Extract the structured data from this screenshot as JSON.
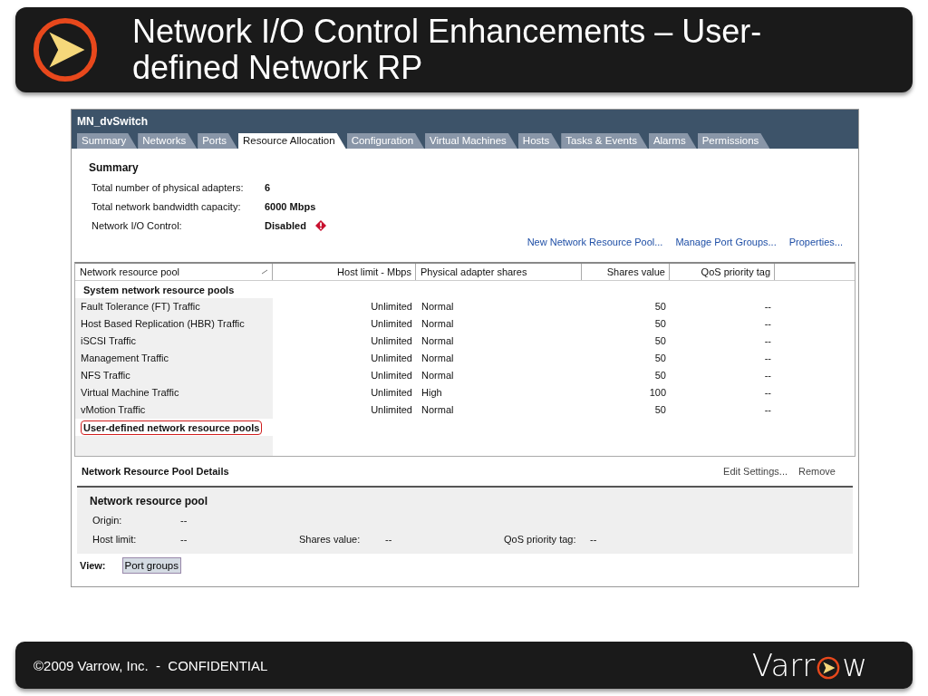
{
  "title_lines": [
    "Network I/O Control Enhancements – User-",
    "defined Network RP"
  ],
  "screenshot": {
    "header": "MN_dvSwitch",
    "tabs": [
      {
        "label": "Summary",
        "selected": false
      },
      {
        "label": "Networks",
        "selected": false
      },
      {
        "label": "Ports",
        "selected": false
      },
      {
        "label": "Resource Allocation",
        "selected": true
      },
      {
        "label": "Configuration",
        "selected": false
      },
      {
        "label": "Virtual Machines",
        "selected": false
      },
      {
        "label": "Hosts",
        "selected": false
      },
      {
        "label": "Tasks & Events",
        "selected": false
      },
      {
        "label": "Alarms",
        "selected": false
      },
      {
        "label": "Permissions",
        "selected": false
      }
    ],
    "summary": {
      "heading": "Summary",
      "rows": [
        {
          "label": "Total number of physical adapters:",
          "value": "6",
          "warning": false
        },
        {
          "label": "Total network bandwidth capacity:",
          "value": "6000 Mbps",
          "warning": false
        },
        {
          "label": "Network I/O Control:",
          "value": "Disabled",
          "warning": true
        }
      ]
    },
    "links": [
      "New Network Resource Pool...",
      "Manage Port Groups...",
      "Properties..."
    ],
    "table": {
      "columns": [
        {
          "label": "Network resource pool",
          "sorted": true
        },
        {
          "label": "Host limit - Mbps",
          "sorted": false
        },
        {
          "label": "Physical adapter shares",
          "sorted": false
        },
        {
          "label": "Shares value",
          "sorted": false
        },
        {
          "label": "QoS priority tag",
          "sorted": false
        }
      ],
      "groups": [
        {
          "label": "System network resource pools",
          "highlighted": false,
          "rows": [
            [
              "Fault Tolerance (FT) Traffic",
              "Unlimited",
              "Normal",
              "50",
              "--"
            ],
            [
              "Host Based Replication (HBR) Traffic",
              "Unlimited",
              "Normal",
              "50",
              "--"
            ],
            [
              "iSCSI Traffic",
              "Unlimited",
              "Normal",
              "50",
              "--"
            ],
            [
              "Management Traffic",
              "Unlimited",
              "Normal",
              "50",
              "--"
            ],
            [
              "NFS Traffic",
              "Unlimited",
              "Normal",
              "50",
              "--"
            ],
            [
              "Virtual Machine Traffic",
              "Unlimited",
              "High",
              "100",
              "--"
            ],
            [
              "vMotion Traffic",
              "Unlimited",
              "Normal",
              "50",
              "--"
            ]
          ]
        },
        {
          "label": "User-defined network resource pools",
          "highlighted": true
        }
      ]
    },
    "details": {
      "heading": "Network Resource Pool Details",
      "actions": [
        "Edit Settings...",
        "Remove"
      ],
      "panel": {
        "heading": "Network resource pool",
        "rows": [
          [
            {
              "label": "Origin:",
              "value": "--"
            }
          ],
          [
            {
              "label": "Host limit:",
              "value": "--"
            },
            {
              "label": "Shares value:",
              "value": "--"
            },
            {
              "label": "QoS priority tag:",
              "value": "--"
            }
          ]
        ]
      },
      "view": {
        "label": "View:",
        "button": "Port groups"
      }
    }
  },
  "footer": {
    "copyright": "©2009 Varrow, Inc.  -  CONFIDENTIAL",
    "logo_before": "Varr",
    "logo_after": "w"
  }
}
